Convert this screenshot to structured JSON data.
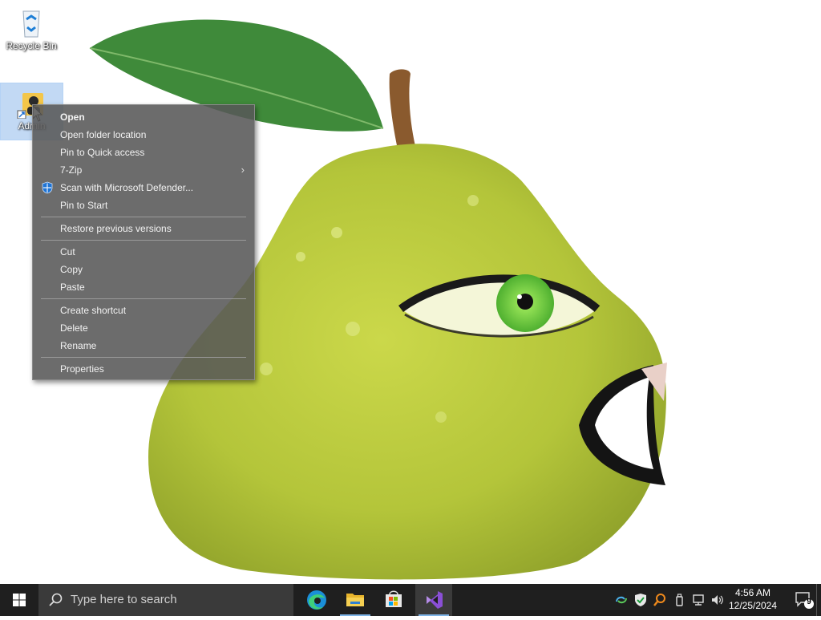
{
  "desktop": {
    "icons": [
      {
        "label": "Recycle Bin"
      },
      {
        "label": "Admin"
      }
    ]
  },
  "context_menu": {
    "items": [
      {
        "label": "Open"
      },
      {
        "label": "Open folder location"
      },
      {
        "label": "Pin to Quick access"
      },
      {
        "label": "7-Zip"
      },
      {
        "label": "Scan with Microsoft Defender..."
      },
      {
        "label": "Pin to Start"
      },
      {
        "label": "Restore previous versions"
      },
      {
        "label": "Cut"
      },
      {
        "label": "Copy"
      },
      {
        "label": "Paste"
      },
      {
        "label": "Create shortcut"
      },
      {
        "label": "Delete"
      },
      {
        "label": "Rename"
      },
      {
        "label": "Properties"
      }
    ]
  },
  "taskbar": {
    "search_placeholder": "Type here to search",
    "apps": [
      "edge-icon",
      "file-explorer-icon",
      "microsoft-store-icon",
      "visual-studio-icon"
    ],
    "clock": {
      "time": "4:56 AM",
      "date": "12/25/2024"
    },
    "notification_count": "9"
  },
  "colors": {
    "taskbar_bg": "#1f1f1f",
    "menu_bg": "#585858",
    "pear_green": "#b3c73a",
    "accent": "#7fb5e8"
  }
}
